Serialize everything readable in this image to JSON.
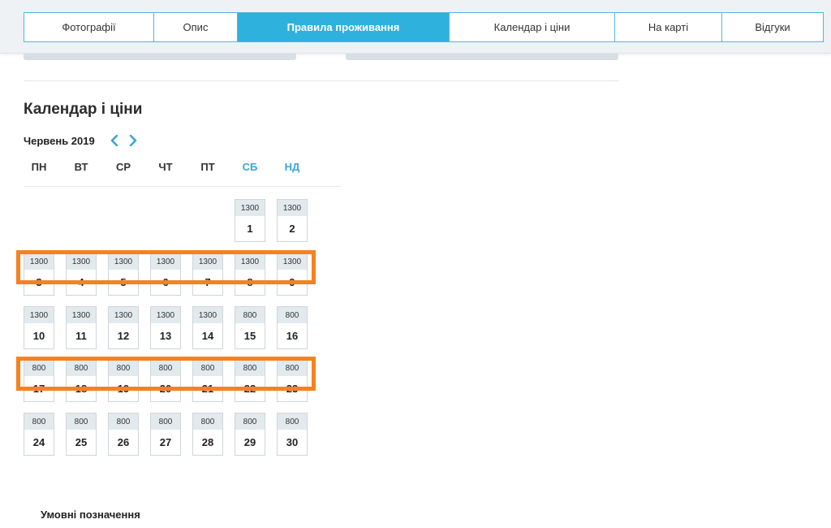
{
  "tabs": [
    {
      "label": "Фотографії",
      "active": false
    },
    {
      "label": "Опис",
      "active": false
    },
    {
      "label": "Правила проживання",
      "active": true
    },
    {
      "label": "Календар і ціни",
      "active": false
    },
    {
      "label": "На карті",
      "active": false
    },
    {
      "label": "Відгуки",
      "active": false
    }
  ],
  "calendar": {
    "title": "Календар і ціни",
    "month": "Червень 2019",
    "prev_icon": "chevron-left-icon",
    "next_icon": "chevron-right-icon",
    "weekdays": [
      {
        "label": "ПН",
        "weekend": false
      },
      {
        "label": "ВТ",
        "weekend": false
      },
      {
        "label": "СР",
        "weekend": false
      },
      {
        "label": "ЧТ",
        "weekend": false
      },
      {
        "label": "ПТ",
        "weekend": false
      },
      {
        "label": "СБ",
        "weekend": true
      },
      {
        "label": "НД",
        "weekend": true
      }
    ],
    "weeks": [
      [
        null,
        null,
        null,
        null,
        null,
        {
          "day": "1",
          "price": "1300"
        },
        {
          "day": "2",
          "price": "1300"
        }
      ],
      [
        {
          "day": "3",
          "price": "1300"
        },
        {
          "day": "4",
          "price": "1300"
        },
        {
          "day": "5",
          "price": "1300"
        },
        {
          "day": "6",
          "price": "1300"
        },
        {
          "day": "7",
          "price": "1300"
        },
        {
          "day": "8",
          "price": "1300"
        },
        {
          "day": "9",
          "price": "1300"
        }
      ],
      [
        {
          "day": "10",
          "price": "1300"
        },
        {
          "day": "11",
          "price": "1300"
        },
        {
          "day": "12",
          "price": "1300"
        },
        {
          "day": "13",
          "price": "1300"
        },
        {
          "day": "14",
          "price": "1300"
        },
        {
          "day": "15",
          "price": "800"
        },
        {
          "day": "16",
          "price": "800"
        }
      ],
      [
        {
          "day": "17",
          "price": "800"
        },
        {
          "day": "18",
          "price": "800"
        },
        {
          "day": "19",
          "price": "800"
        },
        {
          "day": "20",
          "price": "800"
        },
        {
          "day": "21",
          "price": "800"
        },
        {
          "day": "22",
          "price": "800"
        },
        {
          "day": "23",
          "price": "800"
        }
      ],
      [
        {
          "day": "24",
          "price": "800"
        },
        {
          "day": "25",
          "price": "800"
        },
        {
          "day": "26",
          "price": "800"
        },
        {
          "day": "27",
          "price": "800"
        },
        {
          "day": "28",
          "price": "800"
        },
        {
          "day": "29",
          "price": "800"
        },
        {
          "day": "30",
          "price": "800"
        }
      ]
    ],
    "highlighted_weeks": [
      1,
      3
    ],
    "highlight_color": "#f5821f",
    "weekend_color": "#3aa6d8"
  },
  "legend": {
    "title": "Умовні позначення"
  },
  "colors": {
    "accent": "#2fb1de",
    "tab_border": "#53b6df",
    "price_bg": "#e2eaee"
  }
}
